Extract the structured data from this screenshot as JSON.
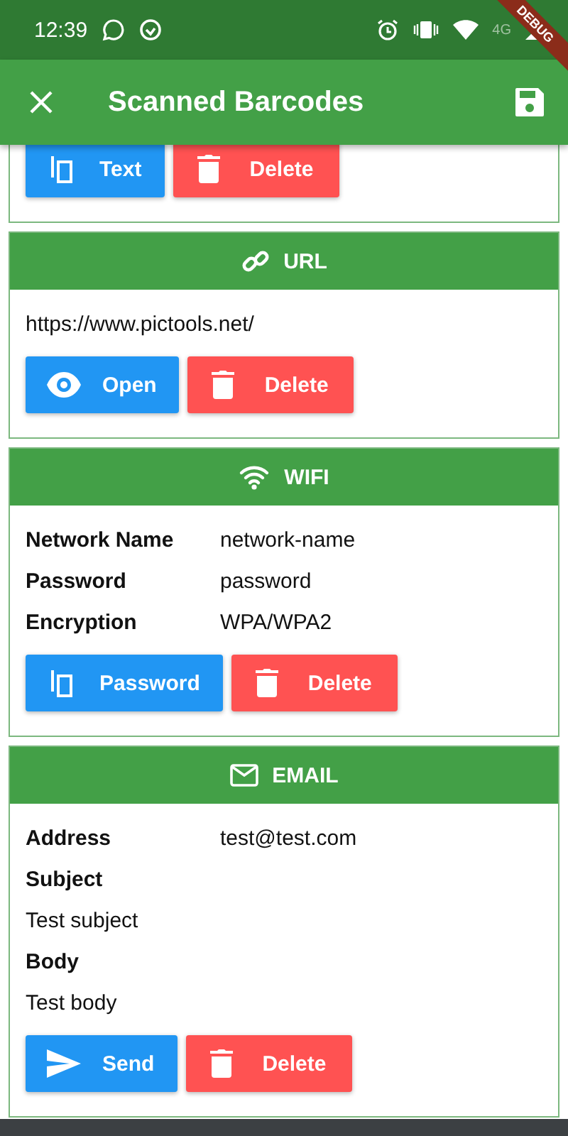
{
  "status_bar": {
    "time": "12:39",
    "network": "4G"
  },
  "debug_banner": "DEBUG",
  "app_bar": {
    "title": "Scanned Barcodes"
  },
  "cards": [
    {
      "buttons": [
        {
          "kind": "copy",
          "label": "Text"
        },
        {
          "kind": "delete",
          "label": "Delete"
        }
      ]
    },
    {
      "kind": "url",
      "title": "URL",
      "fields": [
        {
          "kind": "value",
          "value": "https://www.pictools.net/"
        }
      ],
      "buttons": [
        {
          "kind": "open",
          "label": "Open"
        },
        {
          "kind": "delete",
          "label": "Delete"
        }
      ]
    },
    {
      "kind": "wifi",
      "title": "WIFI",
      "fields": [
        {
          "kind": "pair",
          "label": "Network Name",
          "value": "network-name"
        },
        {
          "kind": "pair",
          "label": "Password",
          "value": "password"
        },
        {
          "kind": "pair",
          "label": "Encryption",
          "value": "WPA/WPA2"
        }
      ],
      "buttons": [
        {
          "kind": "copy",
          "label": "Password"
        },
        {
          "kind": "delete",
          "label": "Delete"
        }
      ]
    },
    {
      "kind": "email",
      "title": "EMAIL",
      "fields": [
        {
          "kind": "pair",
          "label": "Address",
          "value": "test@test.com"
        },
        {
          "kind": "label",
          "label": "Subject"
        },
        {
          "kind": "value",
          "value": "Test subject"
        },
        {
          "kind": "label",
          "label": "Body"
        },
        {
          "kind": "value",
          "value": "Test body"
        }
      ],
      "buttons": [
        {
          "kind": "send",
          "label": "Send"
        },
        {
          "kind": "delete",
          "label": "Delete"
        }
      ]
    }
  ]
}
